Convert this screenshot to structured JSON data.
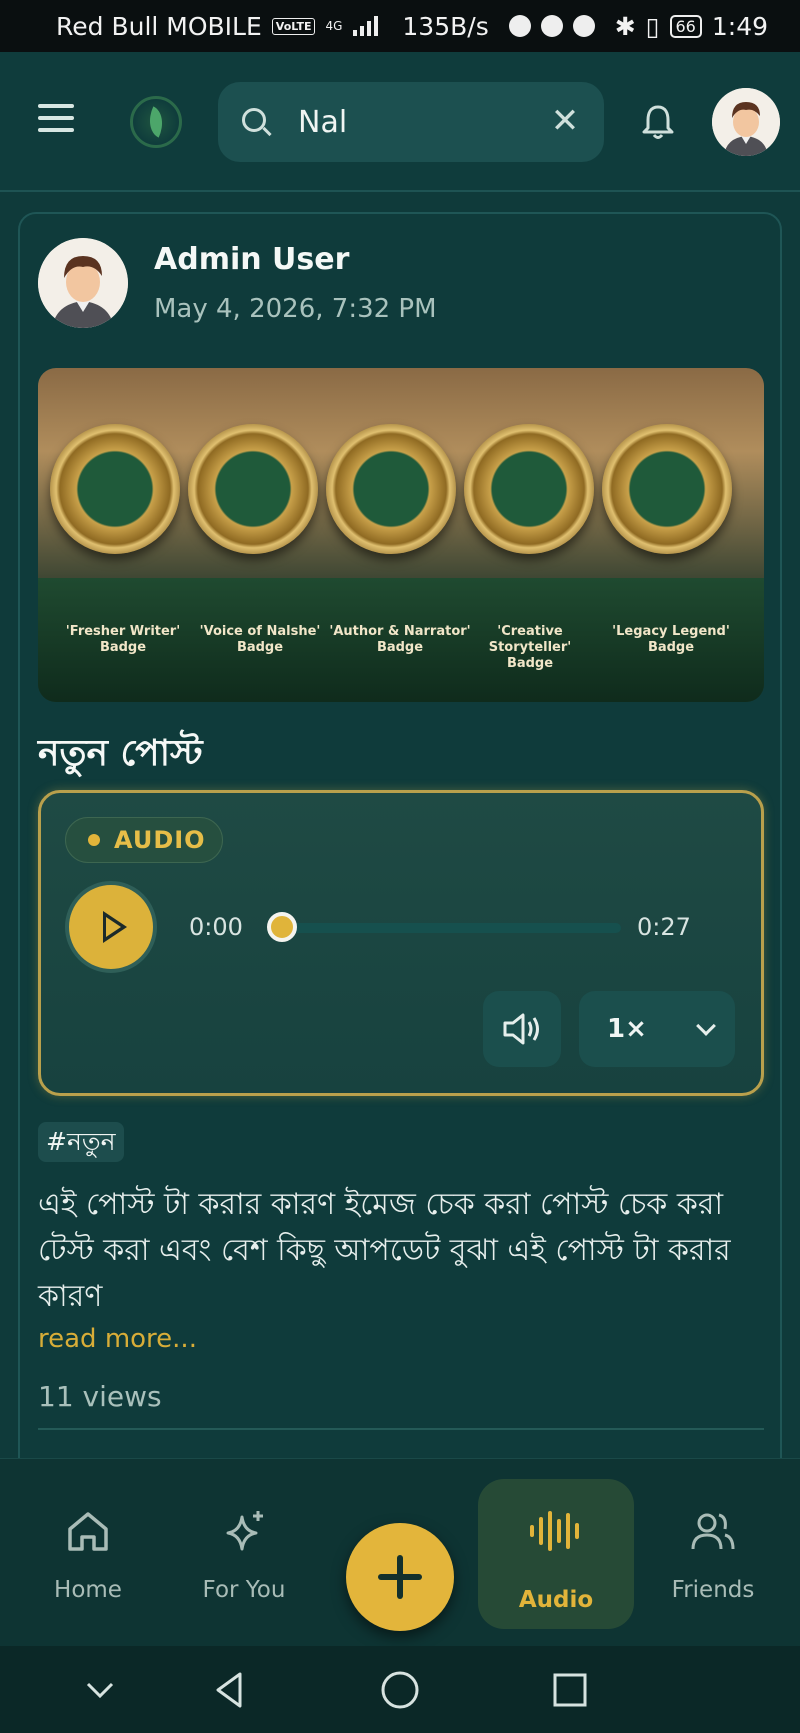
{
  "status_bar": {
    "carrier": "Red Bull MOBILE",
    "volte": "VoLTE",
    "network": "4G",
    "speed": "135B/s",
    "battery": "66",
    "time": "1:49"
  },
  "app_bar": {
    "search": {
      "value": "Nal"
    }
  },
  "post": {
    "author": "Admin User",
    "date": "May 4, 2026, 7:32 PM",
    "image_badges": [
      "'Fresher Writer' Badge",
      "'Voice of Nalshe' Badge",
      "'Author & Narrator' Badge",
      "'Creative Storyteller' Badge",
      "'Legacy Legend' Badge"
    ],
    "title": "নতুন পোস্ট",
    "audio": {
      "label": "AUDIO",
      "current_time": "0:00",
      "total_time": "0:27",
      "progress": 0,
      "speed": "1×"
    },
    "hashtag": "#নতুন",
    "body": "এই পোস্ট টা করার কারণ ইমেজ চেক করা পোস্ট চেক করা টেস্ট করা এবং বেশ কিছু আপডেট বুঝা এই পোস্ট টা করার কারণ",
    "read_more": "read more...",
    "views": "11 views"
  },
  "bottom_nav": {
    "items": [
      {
        "label": "Home"
      },
      {
        "label": "For You"
      },
      {
        "label": "Audio"
      },
      {
        "label": "Friends"
      }
    ],
    "active": "Audio"
  },
  "colors": {
    "background": "#0f3a3a",
    "accent": "#e2b43a"
  }
}
